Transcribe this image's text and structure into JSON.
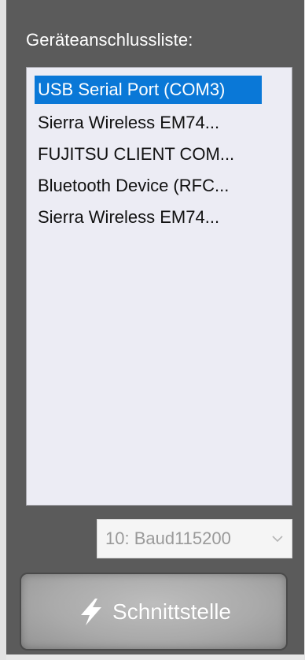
{
  "device_list_label": "Geräteanschlussliste:",
  "devices": [
    {
      "label": "USB Serial Port (COM3)",
      "selected": true
    },
    {
      "label": "Sierra Wireless EM74...",
      "selected": false
    },
    {
      "label": "FUJITSU CLIENT COM...",
      "selected": false
    },
    {
      "label": "Bluetooth Device (RFC...",
      "selected": false
    },
    {
      "label": "Sierra Wireless EM74...",
      "selected": false
    }
  ],
  "baud_select": {
    "value": "10:  Baud115200",
    "icon": "chevron-down-icon"
  },
  "connect_button": {
    "label": "Schnittstelle",
    "icon": "lightning-bolt-icon"
  },
  "colors": {
    "panel": "#5b5b5b",
    "selection": "#0a78d7",
    "listbox_bg": "#ececf4",
    "button_bg": "#aaaaaa"
  }
}
